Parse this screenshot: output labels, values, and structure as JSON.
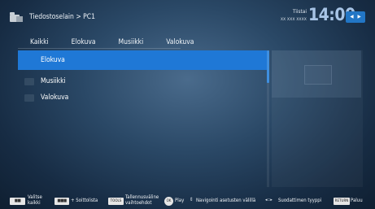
{
  "header": {
    "breadcrumb": "Tiedostoselain > PC1",
    "day": "Tiistai",
    "date": "xx xxx xxxx",
    "time": "14:00"
  },
  "tabs": [
    "Kaikki",
    "Elokuva",
    "Musiikki",
    "Valokuva"
  ],
  "list": {
    "items": [
      {
        "label": "Elokuva",
        "selected": true
      },
      {
        "label": "Musiikki",
        "selected": false
      },
      {
        "label": "Valokuva",
        "selected": false
      }
    ]
  },
  "footer": {
    "select_all": "Valitse kaikki",
    "playlist": "+ Soittolista",
    "storage_key": "TOOLS",
    "storage": "Tallennusväline vaihtoehdot",
    "play_key": "OK",
    "play": "Play",
    "nav": "Navigointi asetusten välillä",
    "filter": "Suodattimen tyyppi",
    "back_key": "RETURN",
    "back": "Paluu"
  },
  "colors": {
    "accent": "#1f78d6",
    "background": "#2a4866",
    "clock": "#a7c4e6"
  }
}
